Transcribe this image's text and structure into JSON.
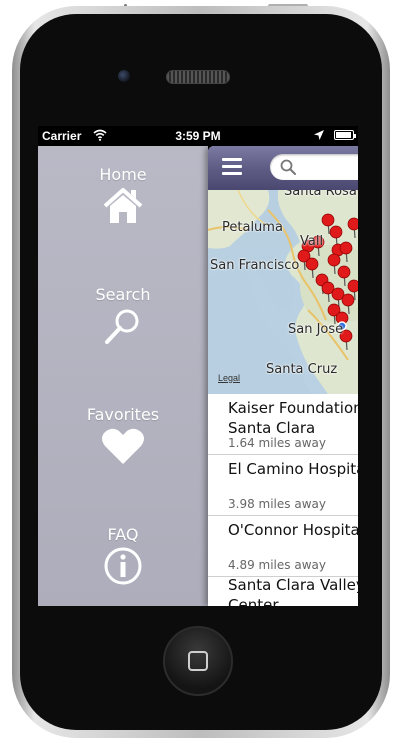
{
  "status_bar": {
    "carrier": "Carrier",
    "time": "3:59 PM"
  },
  "side_menu": {
    "items": [
      {
        "label": "Home",
        "icon": "home-icon"
      },
      {
        "label": "Search",
        "icon": "magnifier-icon"
      },
      {
        "label": "Favorites",
        "icon": "heart-icon"
      },
      {
        "label": "FAQ",
        "icon": "info-icon"
      }
    ]
  },
  "nav_bar": {
    "menu_icon": "hamburger-icon",
    "search_placeholder": ""
  },
  "map": {
    "labels": [
      "Santa Rosa",
      "Petaluma",
      "Vall",
      "San Francisco",
      "San Jose",
      "Santa Cruz"
    ],
    "legal_link": "Legal"
  },
  "results": [
    {
      "name_line1": "Kaiser Foundation H",
      "name_line2": "Santa Clara",
      "distance": "1.64 miles away"
    },
    {
      "name_line1": "El Camino Hospital",
      "name_line2": "",
      "distance": "3.98 miles away"
    },
    {
      "name_line1": "O'Connor Hospital",
      "name_line2": "",
      "distance": "4.89 miles away"
    },
    {
      "name_line1": "Santa Clara Valley M",
      "name_line2": "Center",
      "distance": ""
    }
  ],
  "colors": {
    "menu_bg": "#b2b2c0",
    "nav_bar": "#5f5d86",
    "pin": "#e01a1a"
  }
}
